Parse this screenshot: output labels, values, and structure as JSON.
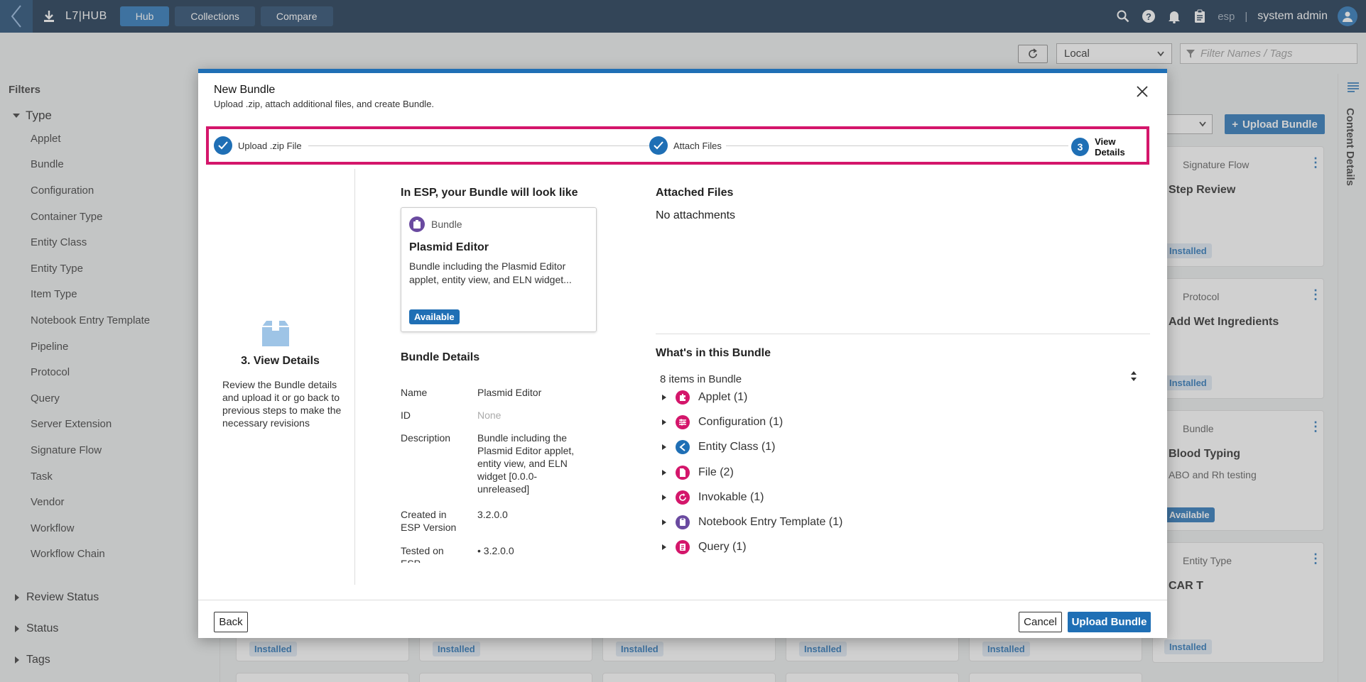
{
  "app": {
    "name": "L7|HUB"
  },
  "nav": {
    "hub": "Hub",
    "collections": "Collections",
    "compare": "Compare"
  },
  "topbar": {
    "tenant": "esp",
    "separator": "|",
    "user": "system admin"
  },
  "toolbar": {
    "scope_value": "Local",
    "filter_placeholder": "Filter Names / Tags",
    "upload_bundle": "Upload Bundle"
  },
  "filters": {
    "title": "Filters",
    "type_label": "Type",
    "types": [
      "Applet",
      "Bundle",
      "Configuration",
      "Container Type",
      "Entity Class",
      "Entity Type",
      "Item Type",
      "Notebook Entry Template",
      "Pipeline",
      "Protocol",
      "Query",
      "Server Extension",
      "Signature Flow",
      "Task",
      "Vendor",
      "Workflow",
      "Workflow Chain"
    ],
    "sections": [
      "Review Status",
      "Status",
      "Tags"
    ]
  },
  "right_panel": {
    "label": "Content Details"
  },
  "bg_cards": [
    {
      "type": "Signature Flow",
      "title": "Step Review",
      "desc": "",
      "status": "Installed"
    },
    {
      "type": "Protocol",
      "title": "Add Wet Ingredients",
      "desc": "",
      "status": "Installed"
    },
    {
      "type": "Bundle",
      "title": "Blood Typing",
      "desc": "ABO and Rh testing",
      "status": "Available"
    },
    {
      "type": "Entity Type",
      "title": "CAR T",
      "desc": "",
      "status": "Installed"
    }
  ],
  "bottom_badges": [
    "Installed",
    "Installed",
    "Installed",
    "Installed",
    "Installed"
  ],
  "modal": {
    "title": "New Bundle",
    "subtitle": "Upload .zip, attach additional files, and create Bundle.",
    "steps": [
      {
        "label": "Upload .zip File",
        "state": "done"
      },
      {
        "label": "Attach Files",
        "state": "done"
      },
      {
        "number": "3",
        "label": "View Details",
        "state": "current"
      }
    ],
    "step_panel": {
      "title": "3. View Details",
      "description": "Review the Bundle details and upload it or go back to previous steps to make the necessary revisions"
    },
    "preview": {
      "heading": "In ESP, your Bundle will look like",
      "type": "Bundle",
      "name": "Plasmid Editor",
      "description": "Bundle including the Plasmid Editor applet, entity view, and ELN widget...",
      "status": "Available"
    },
    "details": {
      "heading": "Bundle Details",
      "name_label": "Name",
      "name_value": "Plasmid Editor",
      "id_label": "ID",
      "id_value": "None",
      "description_label": "Description",
      "description_value": "Bundle including the Plasmid Editor applet, entity view, and ELN widget [0.0.0-unreleased]",
      "created_label": "Created in ESP Version",
      "created_value": "3.2.0.0",
      "tested_label": "Tested on ESP",
      "tested_value": "3.2.0.0"
    },
    "attached": {
      "heading": "Attached Files",
      "empty_text": "No attachments"
    },
    "contents": {
      "heading": "What's in this Bundle",
      "count_text": "8 items in Bundle",
      "items": [
        {
          "label": "Applet (1)",
          "icon": "puzzle-icon",
          "color": "#d4166b"
        },
        {
          "label": "Configuration (1)",
          "icon": "sliders-icon",
          "color": "#d4166b"
        },
        {
          "label": "Entity Class (1)",
          "icon": "chevron-left-icon",
          "color": "#1f6fb5"
        },
        {
          "label": "File (2)",
          "icon": "file-icon",
          "color": "#d4166b"
        },
        {
          "label": "Invokable (1)",
          "icon": "refresh-icon",
          "color": "#d4166b"
        },
        {
          "label": "Notebook Entry Template (1)",
          "icon": "notebook-icon",
          "color": "#6a4aa0"
        },
        {
          "label": "Query (1)",
          "icon": "query-icon",
          "color": "#d4166b"
        }
      ]
    },
    "buttons": {
      "back": "Back",
      "cancel": "Cancel",
      "upload": "Upload Bundle"
    }
  }
}
